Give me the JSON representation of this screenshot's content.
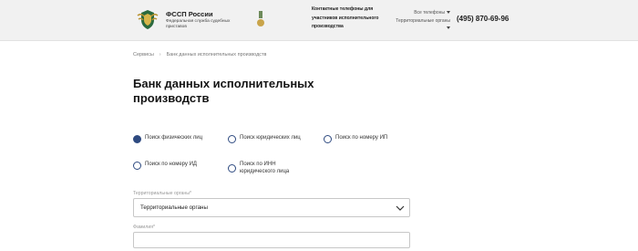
{
  "header": {
    "brand_title": "ФССП России",
    "brand_subtitle": "Федеральная служба судебных приставов",
    "contacts_link": "Контактные телефоны для участников исполнительного производства",
    "menu_all_phones": "Все телефоны",
    "menu_territorial": "Территориальные органы",
    "phone": "(495) 870-69-96"
  },
  "breadcrumb": {
    "root": "Сервисы",
    "separator": "›",
    "current": "Банк данных исполнительных производств"
  },
  "page_title": "Банк данных исполнительных производств",
  "search_options": [
    {
      "label": "Поиск физических лиц",
      "checked": true
    },
    {
      "label": "Поиск юридических лиц",
      "checked": false
    },
    {
      "label": "Поиск по номеру ИП",
      "checked": false
    },
    {
      "label": "Поиск по номеру ИД",
      "checked": false
    },
    {
      "label": "Поиск по ИНН юридического лица",
      "checked": false
    }
  ],
  "form": {
    "territorial_label": "Территориальные органы*",
    "territorial_value": "Территориальные органы",
    "surname_label": "Фамилия*",
    "surname_value": ""
  },
  "colors": {
    "accent": "#2e4a80",
    "header_bg": "#f1f1f1",
    "border": "#c7c7c7"
  },
  "icons": [
    "emblem-logo-icon",
    "medal-icon",
    "caret-down-icon",
    "chevron-down-icon"
  ]
}
